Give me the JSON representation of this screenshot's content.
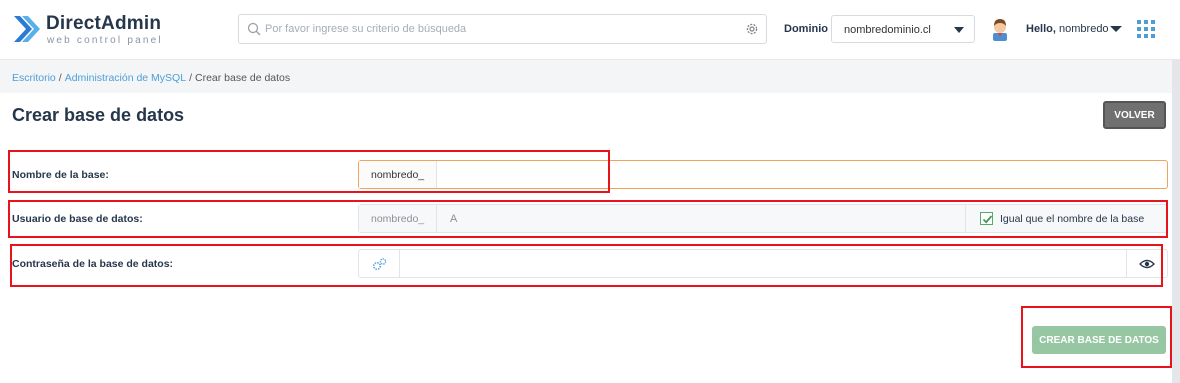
{
  "brand": {
    "title": "DirectAdmin",
    "subtitle": "web control panel"
  },
  "search": {
    "placeholder": "Por favor ingrese su criterio de búsqueda",
    "value": ""
  },
  "domain": {
    "label": "Dominio",
    "selected": "nombredominio.cl"
  },
  "user": {
    "greeting": "Hello,",
    "name": "nombredo"
  },
  "breadcrumb": {
    "items": [
      {
        "label": "Escritorio",
        "link": true
      },
      {
        "label": "Administración de MySQL",
        "link": true
      },
      {
        "label": "Crear base de datos",
        "link": false
      }
    ],
    "separator": "/"
  },
  "page": {
    "title": "Crear base de datos",
    "back_label": "VOLVER"
  },
  "form": {
    "db_name": {
      "label": "Nombre de la base:",
      "prefix": "nombredo_",
      "value": ""
    },
    "db_user": {
      "label": "Usuario de base de datos:",
      "prefix": "nombredo_",
      "value": "A",
      "same_label": "Igual que el nombre de la base",
      "same_checked": true
    },
    "db_password": {
      "label": "Contraseña de la base de datos:",
      "value": ""
    },
    "submit_label": "CREAR BASE DE DATOS"
  },
  "colors": {
    "accent": "#4e9ed6",
    "brand_dark": "#26374b",
    "focus_border": "#f0a35a",
    "create_button": "#96c7a2",
    "back_button": "#707070",
    "highlight": "#e8141c"
  },
  "icons": {
    "search": "search-icon",
    "settings": "gear-icon",
    "generate_password": "gears-icon",
    "toggle_visibility": "eye-icon",
    "apps": "apps-grid-icon"
  }
}
